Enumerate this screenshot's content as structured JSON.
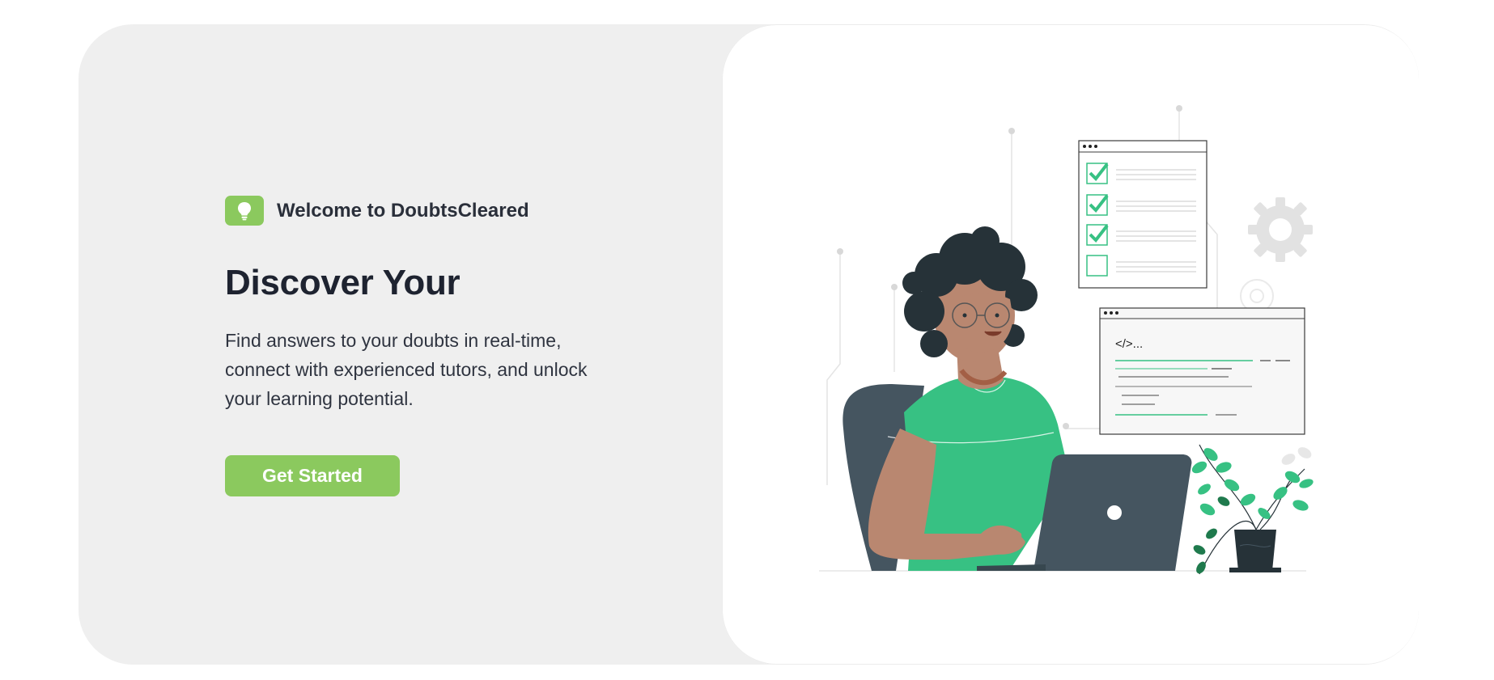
{
  "hero": {
    "badge_icon": "lightbulb-icon",
    "welcome": "Welcome to DoubtsCleared",
    "title": "Discover Your",
    "description": "Find answers to your doubts in real-time, connect with experienced tutors, and unlock your learning potential.",
    "cta_label": "Get Started"
  },
  "illustration": {
    "code_snippet": "</>..."
  },
  "colors": {
    "accent": "#8bc95e",
    "green_shirt": "#37c183",
    "card_bg": "#efefef",
    "dark": "#455560"
  }
}
